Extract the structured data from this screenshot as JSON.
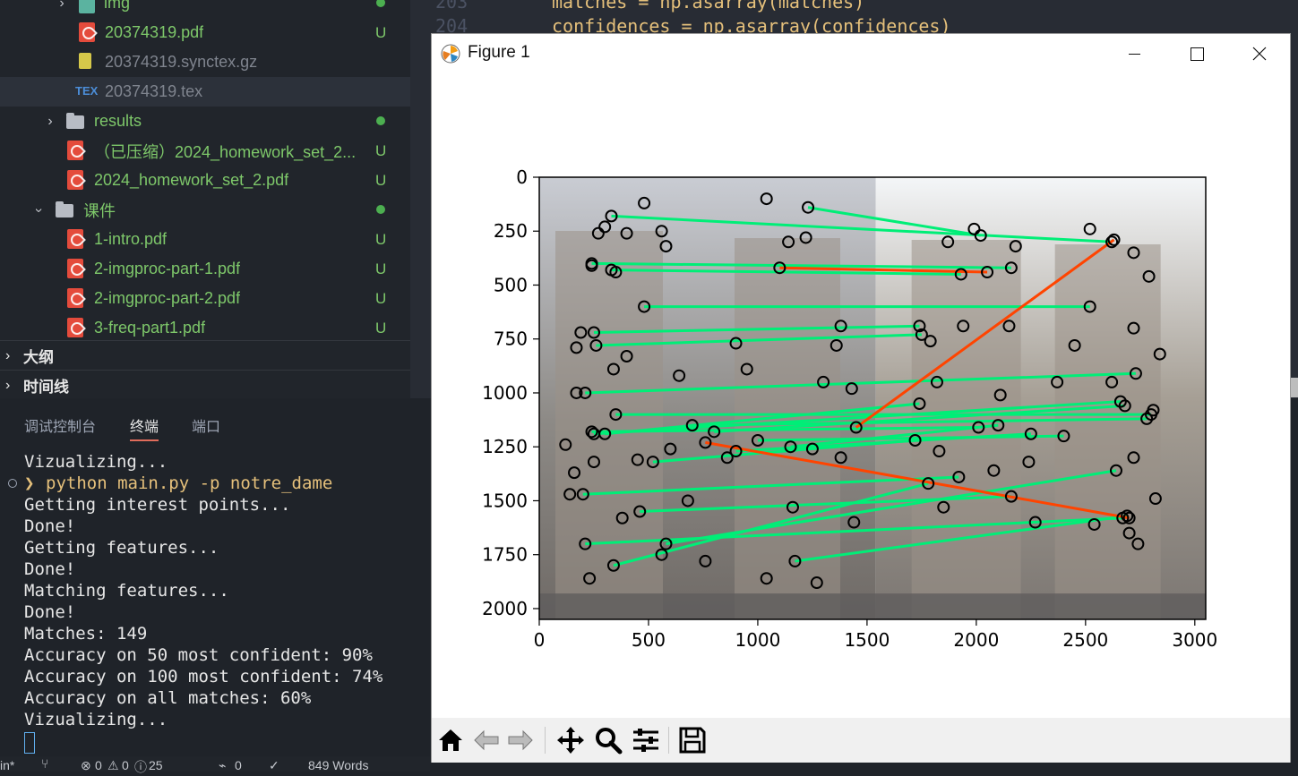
{
  "explorer": {
    "items": [
      {
        "label": "img",
        "status": "",
        "dot": true
      },
      {
        "label": "20374319.pdf",
        "status": "U"
      },
      {
        "label": "20374319.synctex.gz",
        "status": ""
      },
      {
        "label": "20374319.tex",
        "status": ""
      },
      {
        "label": "results",
        "status": "",
        "dot": true
      },
      {
        "label": "（已压缩）2024_homework_set_2...",
        "status": "U"
      },
      {
        "label": "2024_homework_set_2.pdf",
        "status": "U"
      },
      {
        "label": "课件",
        "status": "",
        "dot": true
      },
      {
        "label": "1-intro.pdf",
        "status": "U"
      },
      {
        "label": "2-imgproc-part-1.pdf",
        "status": "U"
      },
      {
        "label": "2-imgproc-part-2.pdf",
        "status": "U"
      },
      {
        "label": "3-freq-part1.pdf",
        "status": "U"
      }
    ],
    "tex_badge": "TEX",
    "sections": [
      "大纲",
      "时间线"
    ]
  },
  "editor": {
    "lines": [
      {
        "num": "203",
        "text": "matches = np.asarray(matches)"
      },
      {
        "num": "204",
        "text": "confidences = np.asarray(confidences)"
      }
    ]
  },
  "panel": {
    "tabs": [
      "调试控制台",
      "终端",
      "端口"
    ],
    "active_tab": 1
  },
  "terminal": {
    "lines": [
      "Vizualizing...",
      "python main.py -p notre_dame",
      "Getting interest points...",
      "Done!",
      "Getting features...",
      "Done!",
      "Matching features...",
      "Done!",
      "Matches: 149",
      "Accuracy on 50 most confident: 90%",
      "Accuracy on 100 most confident: 74%",
      "Accuracy on all matches: 60%",
      "Vizualizing..."
    ],
    "prompt_symbol": "❯"
  },
  "statusbar": {
    "left": "in*",
    "errors": "0",
    "warnings": "0",
    "info": "25",
    "ports": "0",
    "words": "849 Words"
  },
  "figure": {
    "title": "Figure 1",
    "colors": {
      "correct": "#00ee77",
      "wrong": "#ff4400",
      "keypoint": "#000000"
    }
  },
  "chart_data": {
    "type": "scatter",
    "title": "",
    "xlabel": "",
    "ylabel": "",
    "xlim": [
      0,
      3050
    ],
    "ylim": [
      2050,
      0
    ],
    "xticks": [
      0,
      500,
      1000,
      1500,
      2000,
      2500,
      3000
    ],
    "yticks": [
      0,
      250,
      500,
      750,
      1000,
      1250,
      1500,
      1750,
      2000
    ],
    "image_split_x": 1540,
    "correct_matches": [
      [
        330,
        180,
        2620,
        300
      ],
      [
        1230,
        140,
        2020,
        270
      ],
      [
        480,
        600,
        2520,
        600
      ],
      [
        250,
        720,
        1740,
        690
      ],
      [
        260,
        780,
        1750,
        730
      ],
      [
        330,
        430,
        1930,
        450
      ],
      [
        240,
        400,
        2160,
        420
      ],
      [
        210,
        1000,
        2730,
        910
      ],
      [
        300,
        1190,
        1740,
        1050
      ],
      [
        250,
        1190,
        2660,
        1040
      ],
      [
        520,
        1320,
        1720,
        1220
      ],
      [
        700,
        1150,
        2780,
        1120
      ],
      [
        200,
        1470,
        1920,
        1390
      ],
      [
        210,
        1700,
        2670,
        1580
      ],
      [
        340,
        1800,
        1780,
        1420
      ],
      [
        460,
        1550,
        2160,
        1480
      ],
      [
        1170,
        1780,
        2690,
        1570
      ],
      [
        580,
        1700,
        2640,
        1360
      ],
      [
        900,
        1270,
        2250,
        1190
      ],
      [
        1150,
        1250,
        2100,
        1150
      ],
      [
        800,
        1180,
        2680,
        1060
      ],
      [
        240,
        1180,
        2010,
        1160
      ],
      [
        1000,
        1220,
        2400,
        1200
      ],
      [
        350,
        1100,
        2800,
        1100
      ]
    ],
    "wrong_matches": [
      [
        760,
        1230,
        2700,
        1580
      ],
      [
        1450,
        1160,
        2630,
        290
      ],
      [
        1100,
        420,
        2050,
        440
      ]
    ],
    "keypoints": [
      [
        480,
        120
      ],
      [
        1040,
        100
      ],
      [
        300,
        230
      ],
      [
        270,
        260
      ],
      [
        400,
        260
      ],
      [
        560,
        250
      ],
      [
        580,
        320
      ],
      [
        240,
        410
      ],
      [
        350,
        440
      ],
      [
        1140,
        300
      ],
      [
        1220,
        280
      ],
      [
        1870,
        300
      ],
      [
        1990,
        240
      ],
      [
        2180,
        320
      ],
      [
        2520,
        240
      ],
      [
        2720,
        350
      ],
      [
        2790,
        460
      ],
      [
        190,
        720
      ],
      [
        170,
        790
      ],
      [
        400,
        830
      ],
      [
        900,
        770
      ],
      [
        1380,
        690
      ],
      [
        1360,
        780
      ],
      [
        1790,
        760
      ],
      [
        1940,
        690
      ],
      [
        2150,
        690
      ],
      [
        2450,
        780
      ],
      [
        2720,
        700
      ],
      [
        2840,
        820
      ],
      [
        170,
        1000
      ],
      [
        340,
        890
      ],
      [
        640,
        920
      ],
      [
        950,
        890
      ],
      [
        1300,
        950
      ],
      [
        1430,
        980
      ],
      [
        1820,
        950
      ],
      [
        2110,
        1010
      ],
      [
        2370,
        950
      ],
      [
        2620,
        950
      ],
      [
        2810,
        1080
      ],
      [
        120,
        1240
      ],
      [
        160,
        1370
      ],
      [
        250,
        1320
      ],
      [
        450,
        1310
      ],
      [
        600,
        1260
      ],
      [
        860,
        1300
      ],
      [
        1250,
        1260
      ],
      [
        1380,
        1300
      ],
      [
        1830,
        1270
      ],
      [
        2080,
        1360
      ],
      [
        2240,
        1320
      ],
      [
        2720,
        1300
      ],
      [
        140,
        1470
      ],
      [
        380,
        1580
      ],
      [
        680,
        1500
      ],
      [
        1160,
        1530
      ],
      [
        1440,
        1600
      ],
      [
        1850,
        1530
      ],
      [
        2270,
        1600
      ],
      [
        2540,
        1610
      ],
      [
        2820,
        1490
      ],
      [
        2740,
        1700
      ],
      [
        230,
        1860
      ],
      [
        560,
        1750
      ],
      [
        760,
        1780
      ],
      [
        1040,
        1860
      ],
      [
        1270,
        1880
      ],
      [
        2700,
        1650
      ]
    ]
  }
}
